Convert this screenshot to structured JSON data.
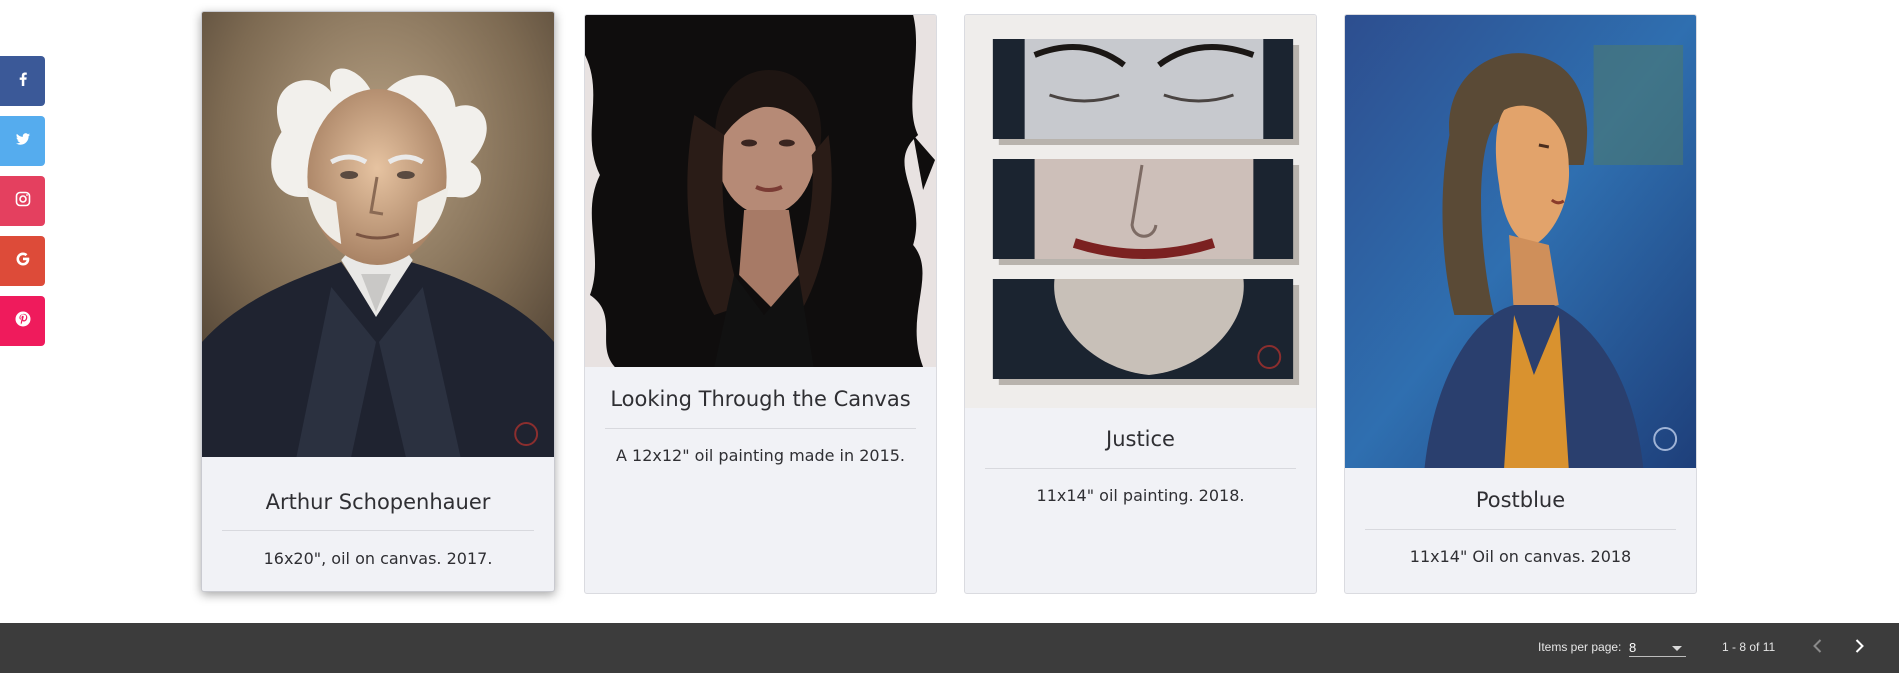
{
  "social": {
    "items": [
      {
        "name": "facebook",
        "icon": "facebook-icon",
        "color": "#3b5998"
      },
      {
        "name": "twitter",
        "icon": "twitter-icon",
        "color": "#55acee"
      },
      {
        "name": "instagram",
        "icon": "instagram-icon",
        "color": "#e4405f"
      },
      {
        "name": "google",
        "icon": "google-icon",
        "color": "#dd4b39"
      },
      {
        "name": "pinterest",
        "icon": "pinterest-icon",
        "color": "#ef1b5c"
      }
    ]
  },
  "cards": [
    {
      "title": "Arthur Schopenhauer",
      "description": "16x20\", oil on canvas. 2017.",
      "image": "portrait-old-man-painting"
    },
    {
      "title": "Looking Through the Canvas",
      "description": "A 12x12\" oil painting made in 2015.",
      "image": "woman-through-black-brushstroke-painting"
    },
    {
      "title": "Justice",
      "description": "11x14\" oil painting. 2018.",
      "image": "face-in-three-panels-painting"
    },
    {
      "title": "Postblue",
      "description": "11x14\" Oil on canvas. 2018",
      "image": "woman-blue-background-painting"
    }
  ],
  "paginator": {
    "items_per_page_label": "Items per page:",
    "items_per_page_value": "8",
    "range_label": "1 - 8 of 11",
    "prev_icon": "chevron-left-icon",
    "next_icon": "chevron-right-icon"
  }
}
